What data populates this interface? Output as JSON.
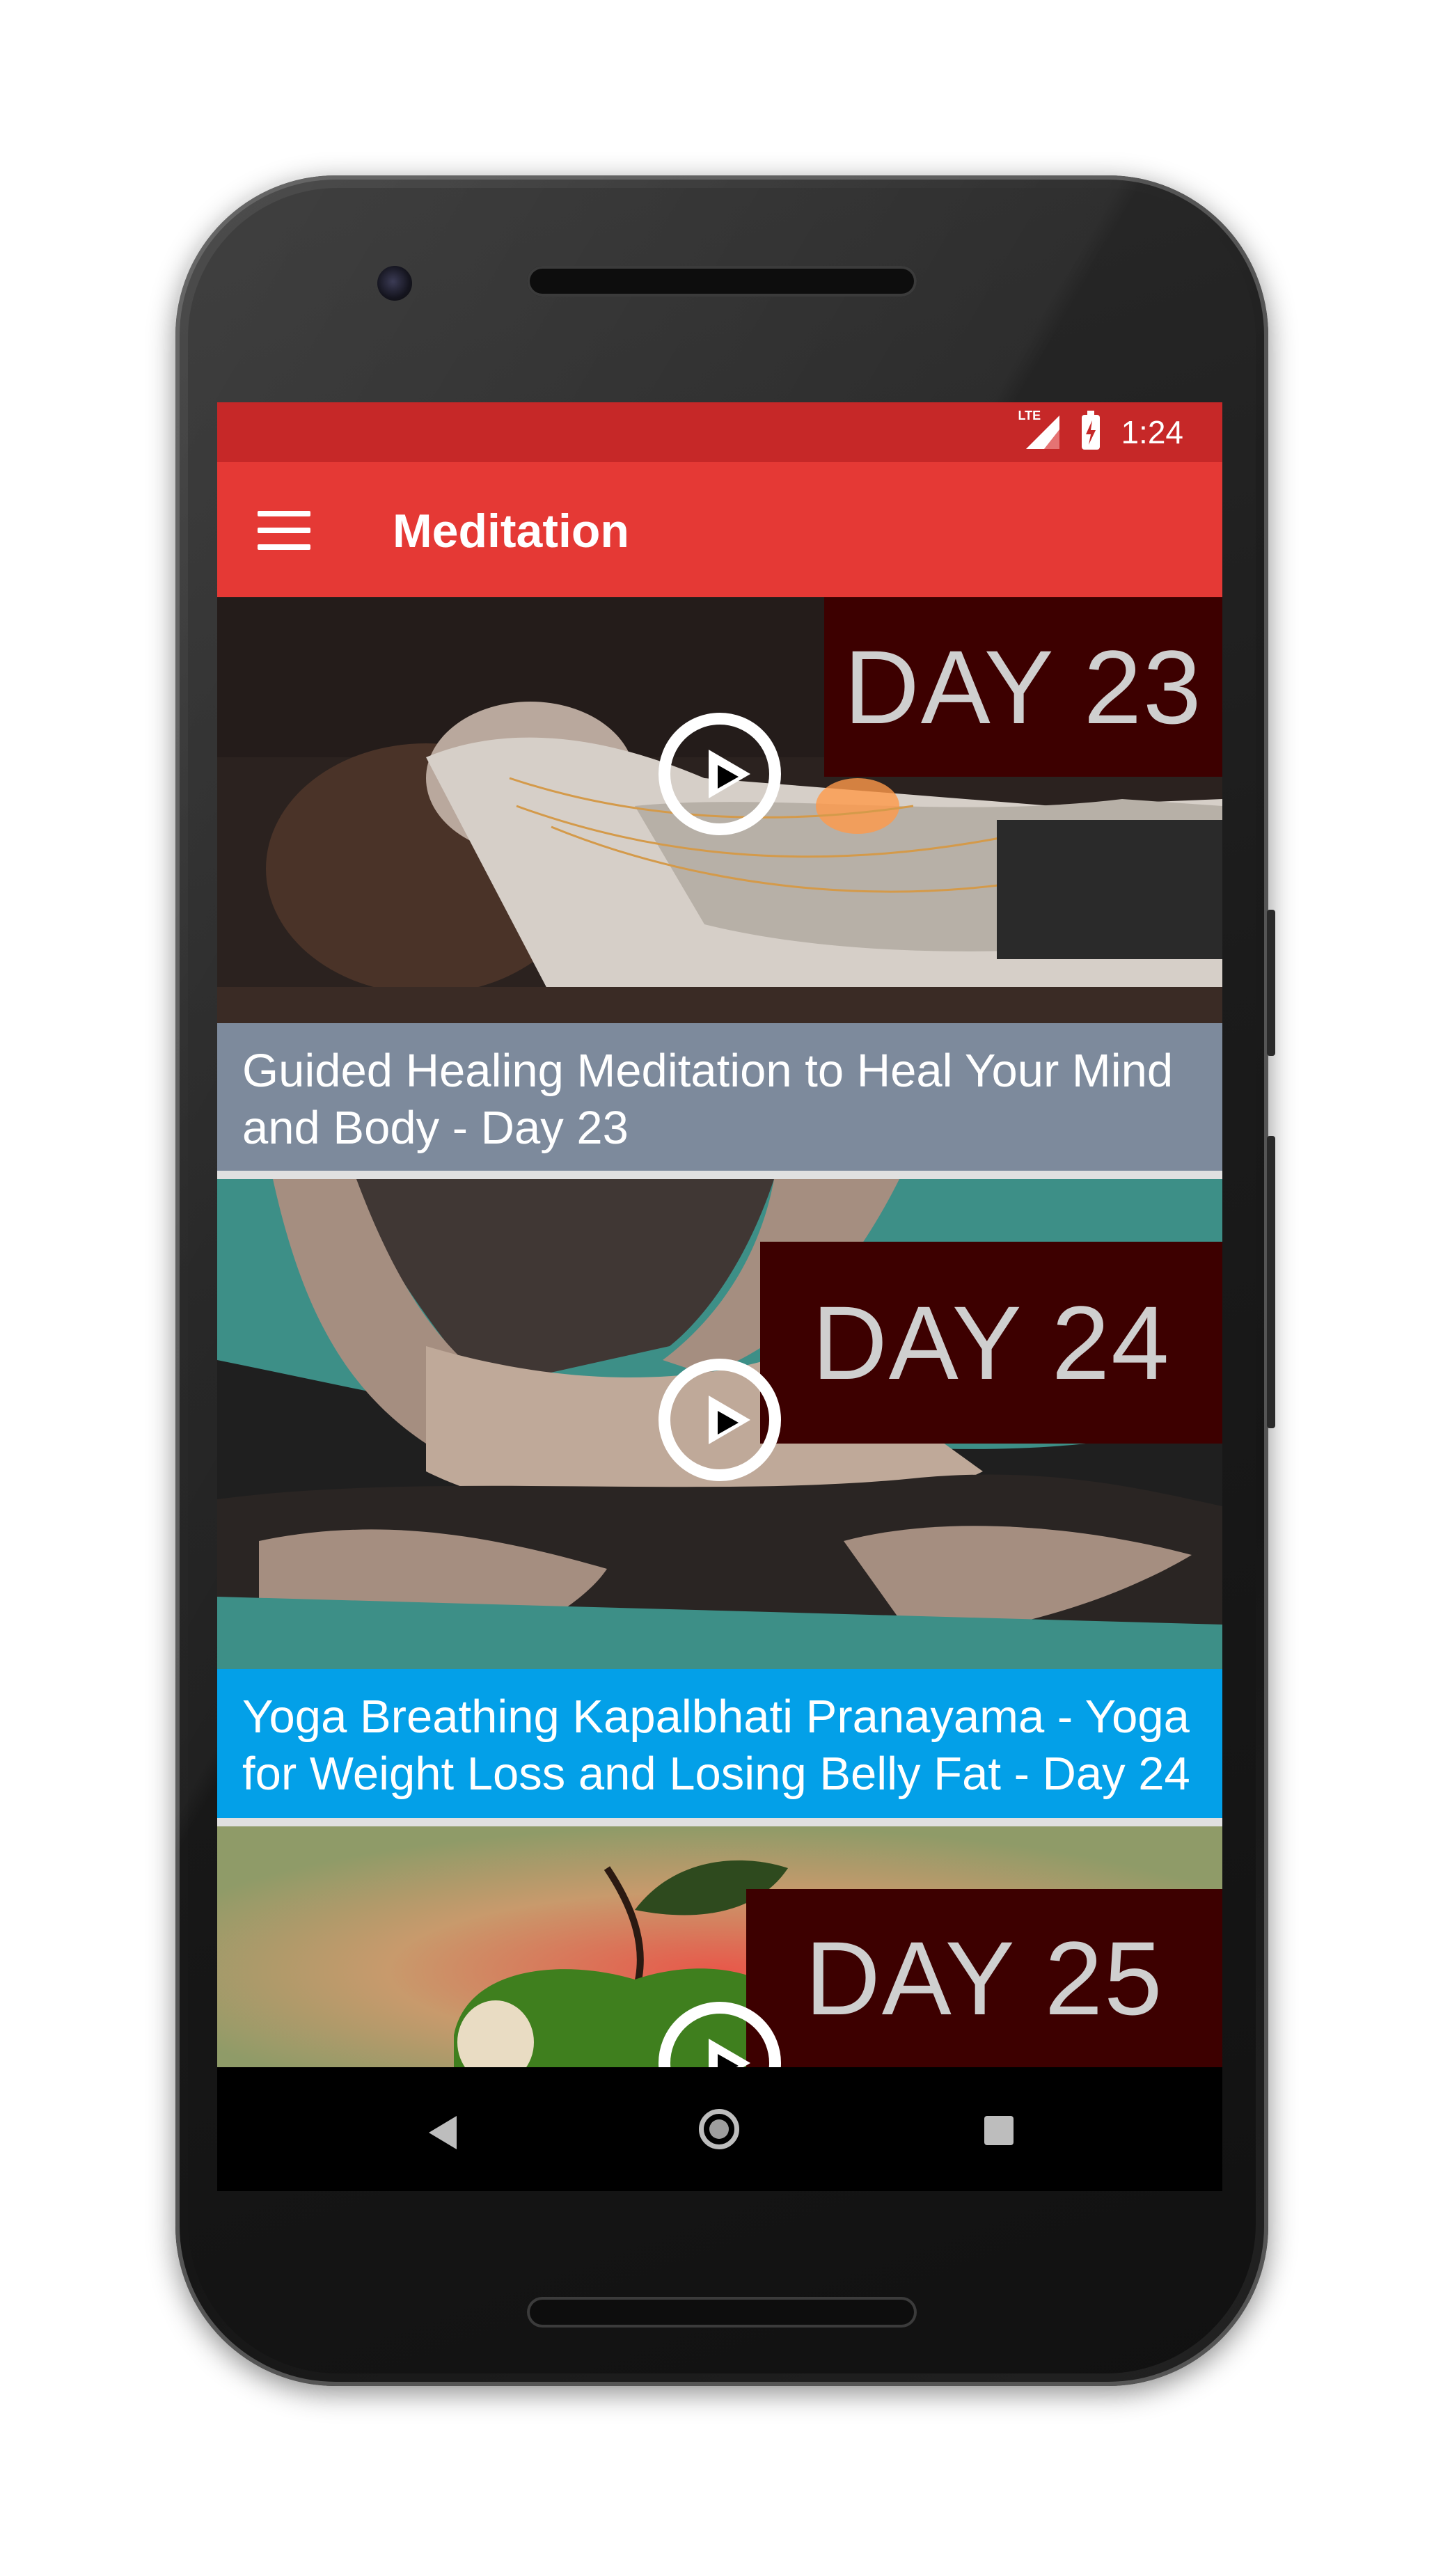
{
  "status_bar": {
    "network": "LTE",
    "time": "1:24"
  },
  "app_bar": {
    "title": "Meditation"
  },
  "videos": [
    {
      "badge": "DAY 23",
      "title": "Guided Healing Meditation to Heal Your Mind and Body - Day 23",
      "caption_color": "#7d8a9c"
    },
    {
      "badge": "DAY 24",
      "title": "Yoga Breathing Kapalbhati Pranayama - Yoga for Weight Loss and Losing Belly Fat - Day 24",
      "caption_color": "#03a0e8"
    },
    {
      "badge": "DAY 25",
      "title": "",
      "caption_color": ""
    }
  ],
  "colors": {
    "status_bar": "#c62828",
    "app_bar": "#e53935"
  }
}
